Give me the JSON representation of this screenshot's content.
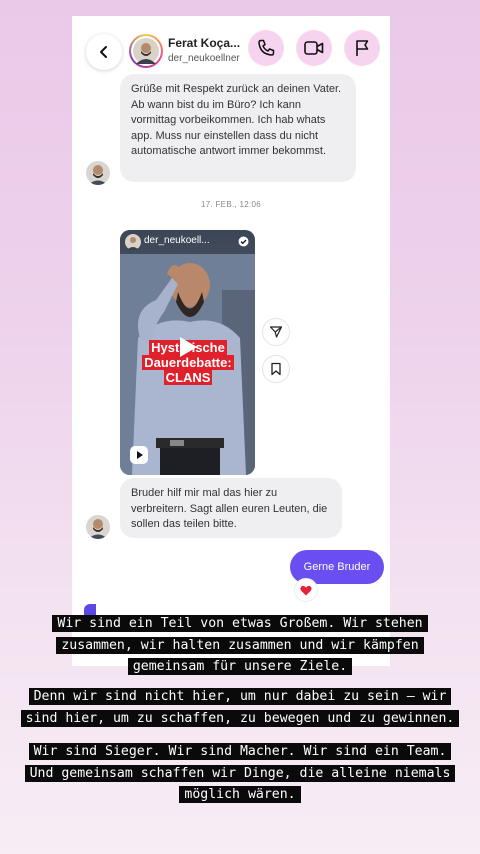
{
  "header": {
    "name": "Ferat Koça...",
    "username": "der_neukoellner"
  },
  "messages": {
    "first": "Grüße mit Respekt zurück an deinen Vater. Ab wann bist du im Büro? Ich kann vormittag vorbeikommen. Ich hab whats app. Muss nur einstellen dass du nicht automatische antwort immer bekommst.",
    "timestamp": "17. FEB., 12:06",
    "reel_user": "der_neukoell...",
    "reel_title_line1": "Hysterische",
    "reel_title_line2": "Dauerdebatte:",
    "reel_title_line3": "CLANS",
    "second": "Bruder hilf mir mal das hier zu verbreitern. Sagt allen euren Leuten, die sollen das teilen bitte.",
    "reply": "Gerne Bruder"
  },
  "captions": {
    "block1": "Wir sind ein Teil von etwas Großem. Wir stehen zusammen, wir halten zusammen und wir kämpfen gemeinsam für unsere Ziele.",
    "block2": "Denn wir sind nicht hier, um nur dabei zu sein – wir sind hier, um zu schaffen, zu bewegen und zu gewinnen.",
    "block3": "Wir sind Sieger. Wir sind Macher. Wir sind ein Team. Und gemeinsam schaffen wir Dinge, die alleine niemals möglich wären."
  },
  "icons": {
    "back": "chevron-left-icon",
    "call": "phone-icon",
    "video": "video-icon",
    "report": "flag-icon",
    "share": "send-icon",
    "save": "bookmark-icon",
    "reaction": "heart-icon",
    "reel_type": "reels-play-icon"
  },
  "colors": {
    "outgoing_bubble": "#6b4ef0",
    "incoming_bubble": "#efeef1",
    "header_icon_bg": "#f6d4f0",
    "reel_title_bg": "#e0202a"
  }
}
